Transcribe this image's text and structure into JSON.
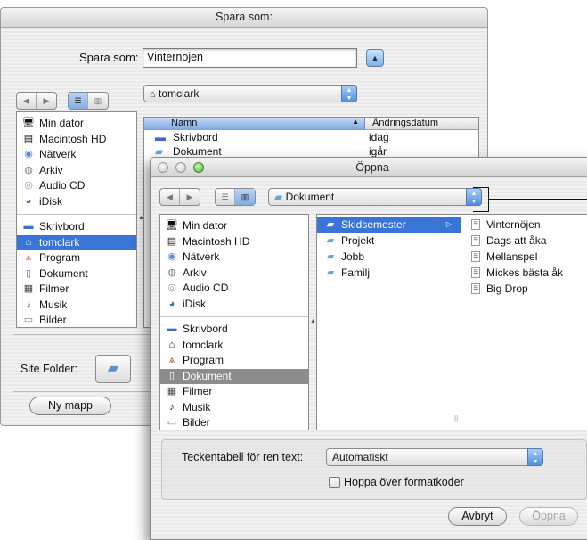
{
  "save_dialog": {
    "title": "Spara som:",
    "save_as_label": "Spara som:",
    "filename_value": "Vinternöjen",
    "disclosure_glyph": "▲",
    "location": "tomclark",
    "sidebar": {
      "devices": [
        "Min dator",
        "Macintosh HD",
        "Nätverk",
        "Arkiv",
        "Audio CD",
        "iDisk"
      ],
      "places": [
        "Skrivbord",
        "tomclark",
        "Program",
        "Dokument",
        "Filmer",
        "Musik",
        "Bilder"
      ]
    },
    "columns": {
      "name": "Namn",
      "modified": "Ändringsdatum"
    },
    "files": [
      {
        "name": "Skrivbord",
        "modified": "idag"
      },
      {
        "name": "Dokument",
        "modified": "igår"
      }
    ],
    "site_folder_label": "Site Folder:",
    "new_folder_button": "Ny mapp"
  },
  "open_dialog": {
    "title": "Öppna",
    "location": "Dokument",
    "sidebar": {
      "devices": [
        "Min dator",
        "Macintosh HD",
        "Nätverk",
        "Arkiv",
        "Audio CD",
        "iDisk"
      ],
      "places": [
        "Skrivbord",
        "tomclark",
        "Program",
        "Dokument",
        "Filmer",
        "Musik",
        "Bilder"
      ]
    },
    "column1": [
      "Skidsemester",
      "Projekt",
      "Jobb",
      "Familj"
    ],
    "column2": [
      "Vinternöjen",
      "Dags att åka",
      "Mellanspel",
      "Mickes bästa åk",
      "Big Drop"
    ],
    "encoding_label": "Teckentabell för ren text:",
    "encoding_value": "Automatiskt",
    "ignore_format_label": "Hoppa över formatkoder",
    "cancel_button": "Avbryt",
    "open_button": "Öppna"
  },
  "colors": {
    "selection_blue": "#3875d7",
    "selection_gray": "#8c8c8c",
    "aqua_blue": "#4f90e0"
  }
}
